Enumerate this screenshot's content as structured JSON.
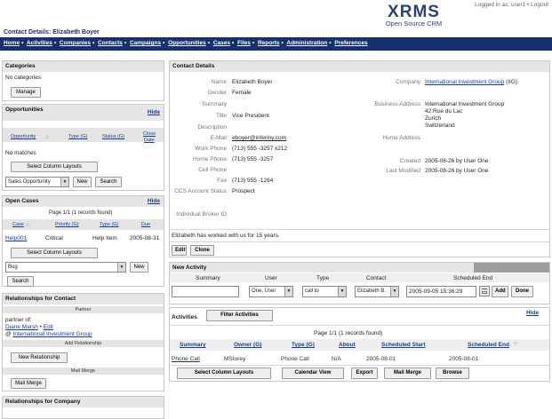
{
  "header": {
    "contact_title": "Contact Details: Elizabeth Boyer",
    "login": "Logged in as: user1 • Logout",
    "logo_big": "XRMS",
    "logo_small": "Open Source CRM"
  },
  "nav": [
    "Home",
    "Activities",
    "Companies",
    "Contacts",
    "Campaigns",
    "Opportunities",
    "Cases",
    "Files",
    "Reports",
    "Administration",
    "Preferences"
  ],
  "sidebar": {
    "categories": {
      "title": "Categories",
      "empty": "No categories",
      "manage": "Manage"
    },
    "opportunities": {
      "title": "Opportunities",
      "hide": "Hide",
      "cols": [
        "Opportunity",
        "Type (G)",
        "Status (G)",
        "Close",
        "Date"
      ],
      "empty": "No matches",
      "layouts_button": "Select Column Layouts",
      "select_value": "Sales Opportunity",
      "new": "New",
      "search": "Search"
    },
    "open_cases": {
      "title": "Open Cases",
      "hide": "Hide",
      "page_info": "Page 1/1 (1 records found)",
      "cols": [
        "Case",
        "Priority (G)",
        "Type (G)",
        "Due"
      ],
      "row": [
        "Help001",
        "Critical",
        "Help Item",
        "2005-08-31"
      ],
      "layouts_button": "Select Column Layouts",
      "select_value": "Bug",
      "new": "New",
      "search": "Search"
    },
    "relationships_contact": {
      "title": "Relationships for Contact",
      "partner_header": "Partner",
      "partner_of": "partner of:",
      "person": "Diane Marsh",
      "edit": "Edit",
      "company_prefix": "@",
      "company": "International Investment Group",
      "add_header": "Add Relationship",
      "new_relationship": "New Relationship",
      "mail_header": "Mail Merge",
      "mail_merge": "Mail Merge"
    },
    "relationships_company": {
      "title": "Relationships for Company"
    }
  },
  "contact_details": {
    "title": "Contact Details",
    "fields": [
      {
        "label": "Name",
        "value": "Elizabeth Boyer"
      },
      {
        "label": "Gender",
        "value": "Female"
      },
      {
        "label": "Summary",
        "value": ""
      },
      {
        "label": "Title",
        "value": "Vice President"
      },
      {
        "label": "Description",
        "value": ""
      },
      {
        "label": "E-Mail",
        "value": "eboyer@inferiny.com"
      },
      {
        "label": "Work Phone",
        "value": "(713) 555 -3257 x212"
      },
      {
        "label": "Home Phone",
        "value": "(713) 555 -3257"
      },
      {
        "label": "Cell Phone",
        "value": ""
      },
      {
        "label": "Fax",
        "value": "(713) 555 -1284"
      },
      {
        "label": "CCS Account Status",
        "value": "Prospect"
      },
      {
        "label": "Individual Broker ID",
        "value": ""
      }
    ],
    "company_label": "Company",
    "company_value": "International Investment Group",
    "company_abbr": "(IIG)",
    "business_address_label": "Business Address",
    "business_address": [
      "International Investment Group",
      "42 Rue du Lac",
      "Zurich",
      "Switzerland"
    ],
    "home_address_label": "Home Address",
    "created_label": "Created",
    "created_value": "2005-08-26 by User One",
    "modified_label": "Last Modified",
    "modified_value": "2005-08-26 by User One",
    "note": "Elizabeth has worked with us for 15 years.",
    "edit": "Edit",
    "clone": "Clone"
  },
  "new_activity": {
    "title": "New Activity",
    "cols": [
      "Summary",
      "User",
      "Type",
      "Contact",
      "Scheduled End"
    ],
    "user_value": "One, User",
    "type_value": "call to",
    "contact_value": "Elizabeth B.",
    "scheduled_end": "2005-09-05 15:36:29",
    "add": "Add",
    "done": "Done"
  },
  "activities": {
    "title": "Activities",
    "filter": "Filter Activities",
    "hide": "Hide",
    "page_info": "Page 1/1 (1 records found)",
    "cols": [
      "Summary",
      "Owner (G)",
      "Type (G)",
      "About",
      "Scheduled Start",
      "Scheduled End"
    ],
    "row": [
      "Phone Call",
      "MStorey",
      "Phone Call",
      "N/A",
      "2005-08-01",
      "2005-08-01"
    ],
    "buttons": [
      "Select Column Layouts",
      "Calendar View",
      "Export",
      "Mail Merge",
      "Browse"
    ]
  }
}
